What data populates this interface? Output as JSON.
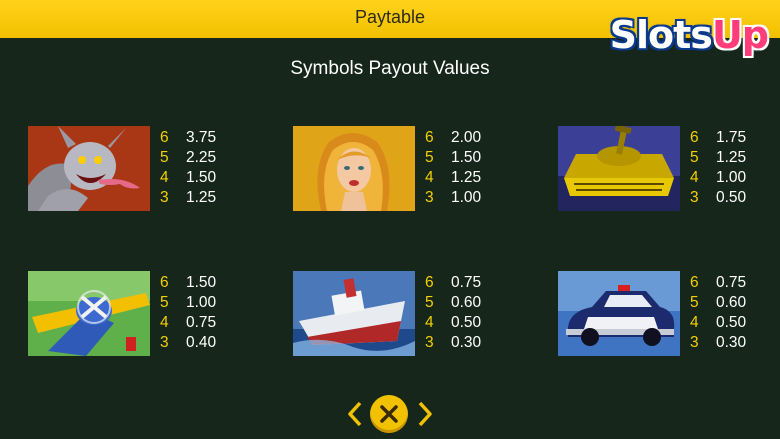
{
  "header": {
    "title": "Paytable"
  },
  "logo": {
    "part1": "Slots",
    "part2": "Up"
  },
  "subtitle": "Symbols Payout Values",
  "symbols": [
    {
      "icon": "demon-icon",
      "pays": [
        {
          "count": "6",
          "value": "3.75"
        },
        {
          "count": "5",
          "value": "2.25"
        },
        {
          "count": "4",
          "value": "1.50"
        },
        {
          "count": "3",
          "value": "1.25"
        }
      ]
    },
    {
      "icon": "woman-icon",
      "pays": [
        {
          "count": "6",
          "value": "2.00"
        },
        {
          "count": "5",
          "value": "1.50"
        },
        {
          "count": "4",
          "value": "1.25"
        },
        {
          "count": "3",
          "value": "1.00"
        }
      ]
    },
    {
      "icon": "tank-icon",
      "pays": [
        {
          "count": "6",
          "value": "1.75"
        },
        {
          "count": "5",
          "value": "1.25"
        },
        {
          "count": "4",
          "value": "1.00"
        },
        {
          "count": "3",
          "value": "0.50"
        }
      ]
    },
    {
      "icon": "airplane-icon",
      "pays": [
        {
          "count": "6",
          "value": "1.50"
        },
        {
          "count": "5",
          "value": "1.00"
        },
        {
          "count": "4",
          "value": "0.75"
        },
        {
          "count": "3",
          "value": "0.40"
        }
      ]
    },
    {
      "icon": "ship-icon",
      "pays": [
        {
          "count": "6",
          "value": "0.75"
        },
        {
          "count": "5",
          "value": "0.60"
        },
        {
          "count": "4",
          "value": "0.50"
        },
        {
          "count": "3",
          "value": "0.30"
        }
      ]
    },
    {
      "icon": "police-car-icon",
      "pays": [
        {
          "count": "6",
          "value": "0.75"
        },
        {
          "count": "5",
          "value": "0.60"
        },
        {
          "count": "4",
          "value": "0.50"
        },
        {
          "count": "3",
          "value": "0.30"
        }
      ]
    }
  ],
  "colors": {
    "background": "#17261b",
    "header": "#ffd21a",
    "count": "#f5d000",
    "value": "#ffffff"
  },
  "nav": {
    "prev_icon": "chevron-left-icon",
    "close_icon": "close-icon",
    "next_icon": "chevron-right-icon"
  }
}
